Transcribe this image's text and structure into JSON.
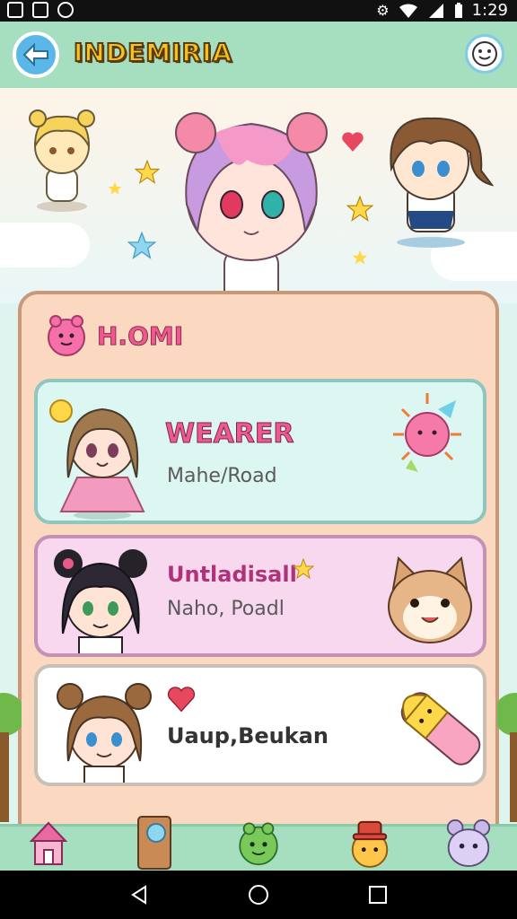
{
  "status_bar": {
    "time": "1:29"
  },
  "app_bar": {
    "title": "INDEMIRIA"
  },
  "panel": {
    "title": "H.OMI",
    "cards": [
      {
        "title": "WEARER",
        "subtitle": "Mahe/Road"
      },
      {
        "title": "Untladisall",
        "subtitle": "Naho, Poadl"
      },
      {
        "title": "Uaup,Beukan",
        "subtitle": ""
      }
    ]
  },
  "colors": {
    "appbar": "#a6dfbf",
    "panel": "#fbd8c0",
    "accent_pink": "#ef5a8e",
    "title_yellow": "#f7c31b"
  },
  "icons": [
    "gallery-icon",
    "notes-icon",
    "app-icon",
    "settings-icon",
    "wifi-icon",
    "signal-icon",
    "battery-icon",
    "back-arrow-icon",
    "smiley-icon",
    "home-icon",
    "phone-icon",
    "frog-icon",
    "hat-icon",
    "bunny-icon"
  ]
}
